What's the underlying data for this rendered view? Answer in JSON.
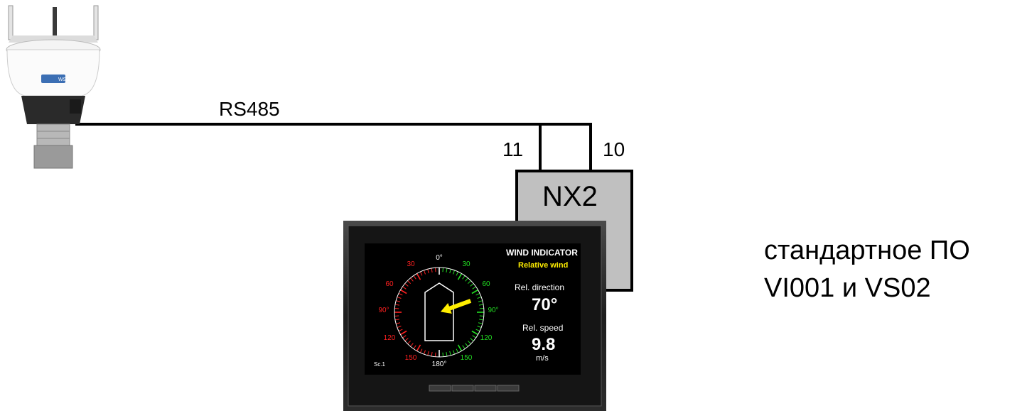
{
  "diagram": {
    "cable_label": "RS485",
    "terminal_left": "11",
    "terminal_right": "10",
    "module_label": "NX2",
    "software_line1": "стандартное ПО",
    "software_line2": "VI001 и VS02",
    "sensor_badge": "WSS"
  },
  "display": {
    "title": "WIND INDICATOR",
    "subtitle": "Relative wind",
    "direction_label": "Rel. direction",
    "direction_value": "70°",
    "speed_label": "Rel. speed",
    "speed_value": "9.8",
    "speed_unit": "m/s",
    "screen_id": "Sc.1",
    "dial": {
      "top": "0°",
      "bottom": "180°",
      "left90": "90°",
      "right90": "90°",
      "port_labels": [
        "30",
        "60",
        "120",
        "150"
      ],
      "stbd_labels": [
        "30",
        "60",
        "120",
        "150"
      ]
    },
    "wind_direction_deg": 70,
    "colors": {
      "port": "#ff2020",
      "starboard": "#22dd22",
      "pointer": "#ffee00"
    }
  }
}
